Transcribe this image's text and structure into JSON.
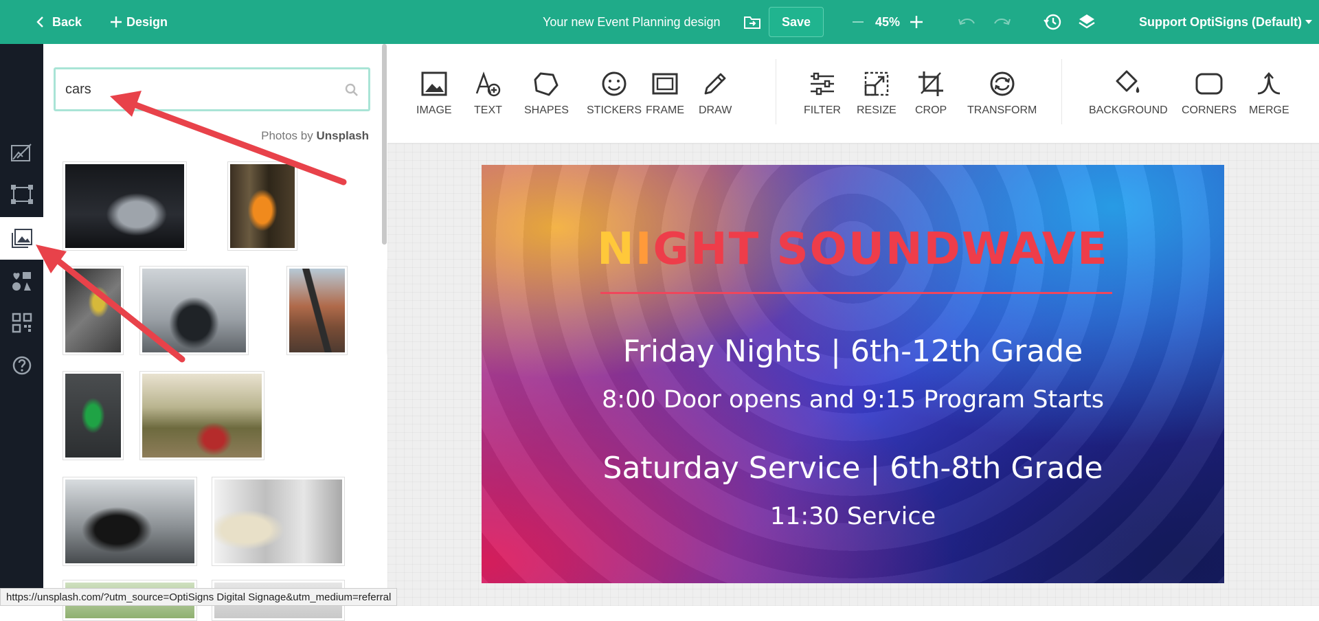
{
  "topbar": {
    "back_label": "Back",
    "design_label": "Design",
    "title": "Your new Event Planning design",
    "save_label": "Save",
    "zoom": "45%",
    "account": "Support OptiSigns (Default)"
  },
  "panel": {
    "search_value": "cars",
    "credit_prefix": "Photos by",
    "credit_source": "Unsplash"
  },
  "toolbar": {
    "image": "IMAGE",
    "text": "TEXT",
    "shapes": "SHAPES",
    "stickers": "STICKERS",
    "frame": "FRAME",
    "draw": "DRAW",
    "filter": "FILTER",
    "resize": "RESIZE",
    "crop": "CROP",
    "transform": "TRANSFORM",
    "background": "BACKGROUND",
    "corners": "CORNERS",
    "merge": "MERGE"
  },
  "design": {
    "title_n": "N",
    "title_i": "I",
    "title_rest": "GHT SOUNDWAVE",
    "line1": "Friday Nights | 6th-12th Grade",
    "line2": "8:00 Door opens and 9:15 Program Starts",
    "line3": "Saturday Service | 6th-8th Grade",
    "line4": "11:30 Service"
  },
  "statusbar": "https://unsplash.com/?utm_source=OptiSigns Digital Signage&utm_medium=referral",
  "colors": {
    "topbar": "#1fab89",
    "rail": "#161c26",
    "annotation_arrow": "#e8424a"
  }
}
